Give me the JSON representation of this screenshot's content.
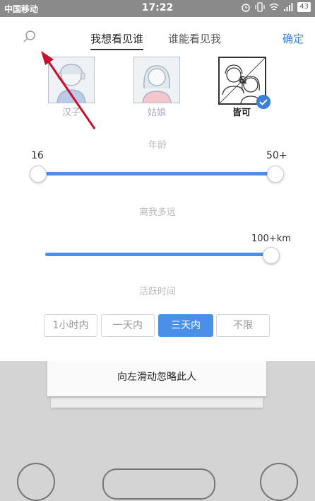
{
  "status_bar": {
    "carrier": "中国移动",
    "time": "17:22",
    "battery": "43"
  },
  "header": {
    "tabs": [
      "我想看见谁",
      "谁能看见我"
    ],
    "confirm": "确定"
  },
  "gender": {
    "options": [
      "汉子",
      "姑娘",
      "皆可"
    ],
    "selected": "皆可"
  },
  "age": {
    "title": "年龄",
    "min": "16",
    "max": "50+"
  },
  "distance": {
    "title": "离我多远",
    "value": "100+km"
  },
  "active_time": {
    "title": "活跃时间",
    "options": [
      "1小时内",
      "一天内",
      "三天内",
      "不限"
    ],
    "selected": "三天内"
  },
  "card": {
    "text": "向左滑动忽略此人"
  },
  "colors": {
    "accent": "#4a8fe8",
    "annotation_arrow": "#c8102e"
  }
}
